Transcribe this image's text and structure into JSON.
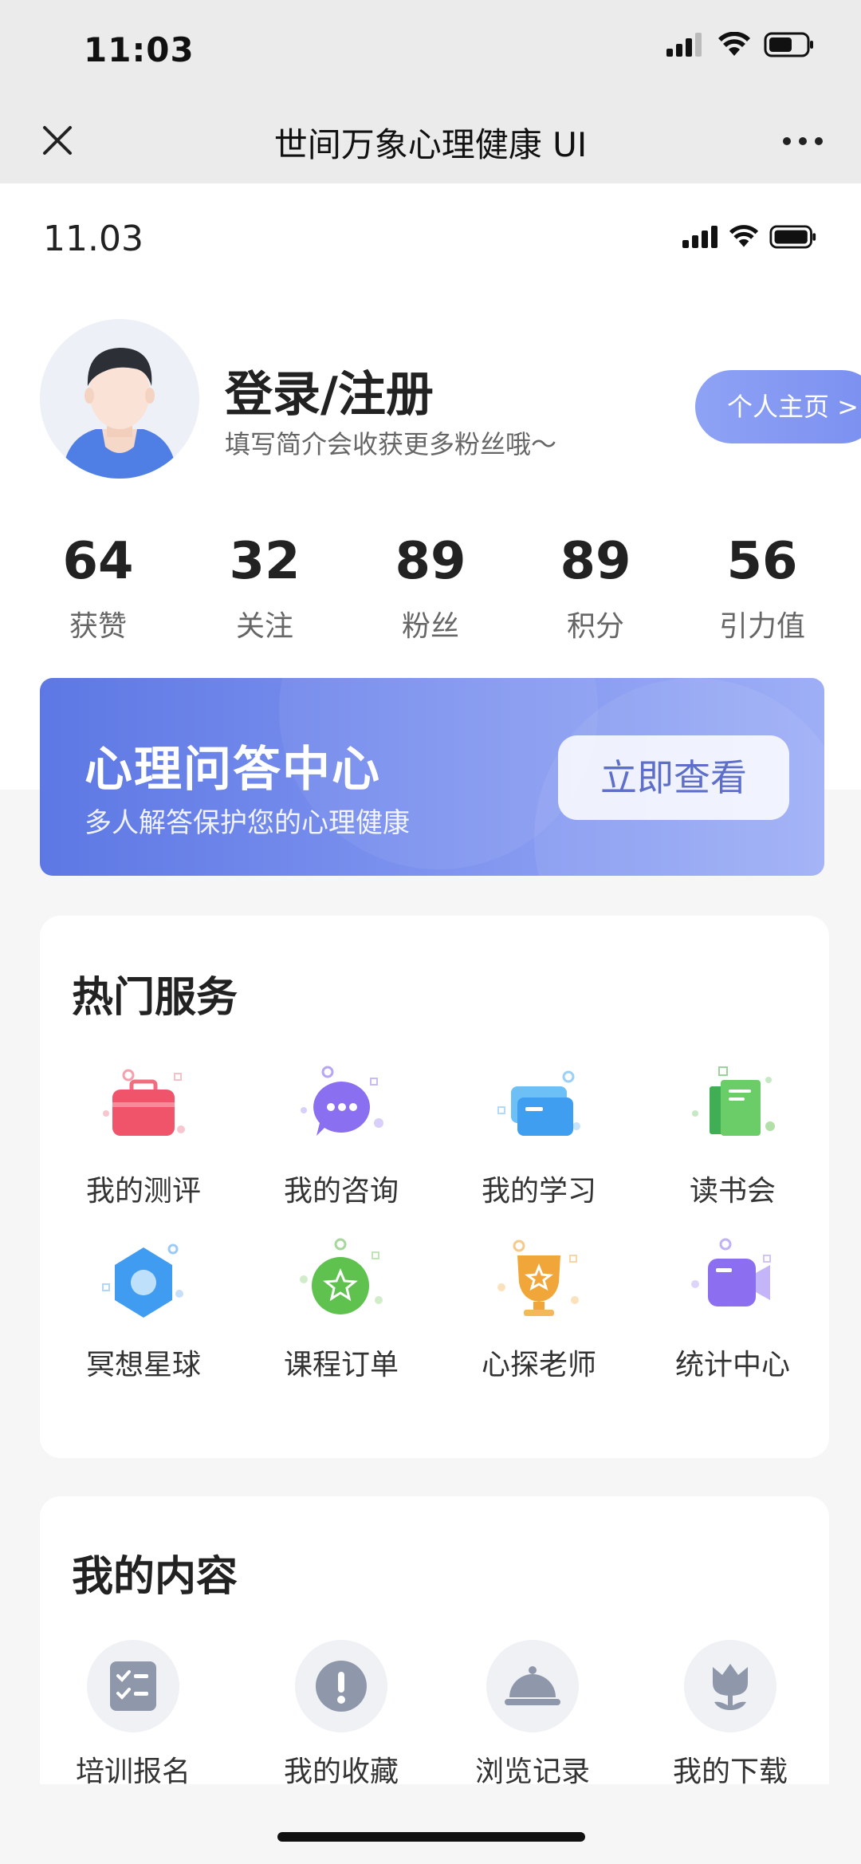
{
  "outer_status": {
    "time": "11:03"
  },
  "navbar": {
    "title": "世间万象心理健康 UI"
  },
  "inner_status": {
    "time": "11.03"
  },
  "profile": {
    "title": "登录/注册",
    "subtitle": "填写简介会收获更多粉丝哦～",
    "home_button": "个人主页 >"
  },
  "stats": [
    {
      "value": "64",
      "label": "获赞"
    },
    {
      "value": "32",
      "label": "关注"
    },
    {
      "value": "89",
      "label": "粉丝"
    },
    {
      "value": "89",
      "label": "积分"
    },
    {
      "value": "56",
      "label": "引力值"
    }
  ],
  "banner": {
    "title": "心理问答中心",
    "subtitle": "多人解答保护您的心理健康",
    "button": "立即查看"
  },
  "hot_services": {
    "title": "热门服务",
    "items": [
      {
        "label": "我的测评",
        "icon": "briefcase-icon",
        "color": "#f0546a"
      },
      {
        "label": "我的咨询",
        "icon": "chat-bubble-icon",
        "color": "#8a6ff0"
      },
      {
        "label": "我的学习",
        "icon": "cards-icon",
        "color": "#4aa8f0"
      },
      {
        "label": "读书会",
        "icon": "book-icon",
        "color": "#5cc36a"
      },
      {
        "label": "冥想星球",
        "icon": "hexagon-icon",
        "color": "#3f9cf0"
      },
      {
        "label": "课程订单",
        "icon": "star-badge-icon",
        "color": "#5fc24f"
      },
      {
        "label": "心探老师",
        "icon": "trophy-icon",
        "color": "#f0a638"
      },
      {
        "label": "统计中心",
        "icon": "camera-icon",
        "color": "#8c6ff0"
      }
    ]
  },
  "my_content": {
    "title": "我的内容",
    "items": [
      {
        "label": "培训报名",
        "icon": "checklist-icon"
      },
      {
        "label": "我的收藏",
        "icon": "alert-icon"
      },
      {
        "label": "浏览记录",
        "icon": "cloche-icon"
      },
      {
        "label": "我的下载",
        "icon": "tulip-icon"
      }
    ]
  }
}
